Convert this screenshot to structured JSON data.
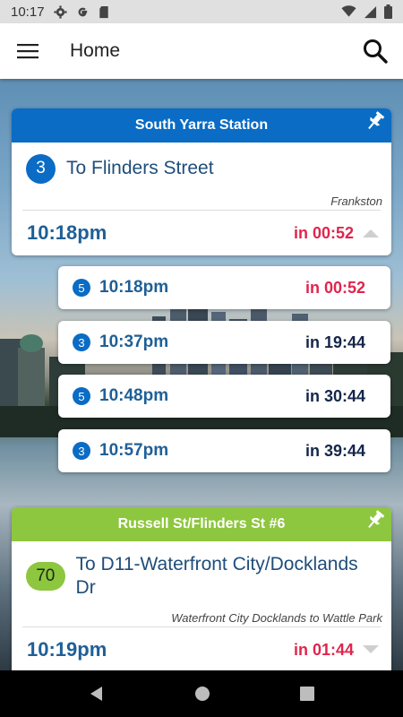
{
  "status_bar": {
    "time": "10:17"
  },
  "app_bar": {
    "title": "Home"
  },
  "stops": [
    {
      "name": "South Yarra Station",
      "header_color": "#0a6cc4",
      "route": "3",
      "destination": "To Flinders Street",
      "via": "Frankston",
      "next_time": "10:18pm",
      "next_in": "in 00:52"
    },
    {
      "name": "Russell St/Flinders St #6",
      "header_color": "#8dc63f",
      "route": "70",
      "destination": "To D11-Waterfront City/Docklands Dr",
      "via": "Waterfront City Docklands to Wattle Park",
      "next_time": "10:19pm",
      "next_in": "in 01:44"
    }
  ],
  "departures": [
    {
      "route": "5",
      "time": "10:18pm",
      "in": "in 00:52",
      "color": "#e0254d"
    },
    {
      "route": "3",
      "time": "10:37pm",
      "in": "in 19:44",
      "color": "#14264a"
    },
    {
      "route": "5",
      "time": "10:48pm",
      "in": "in 30:44",
      "color": "#14264a"
    },
    {
      "route": "3",
      "time": "10:57pm",
      "in": "in 39:44",
      "color": "#14264a"
    }
  ],
  "icons": {
    "status": [
      "settings-icon",
      "google-icon",
      "sd-card-icon",
      "wifi-icon",
      "signal-icon",
      "battery-icon"
    ],
    "app_bar": [
      "menu-icon",
      "search-icon"
    ],
    "card": [
      "pin-icon",
      "chevron-up-icon",
      "chevron-down-icon"
    ],
    "nav": [
      "back-icon",
      "home-icon",
      "recents-icon"
    ]
  }
}
